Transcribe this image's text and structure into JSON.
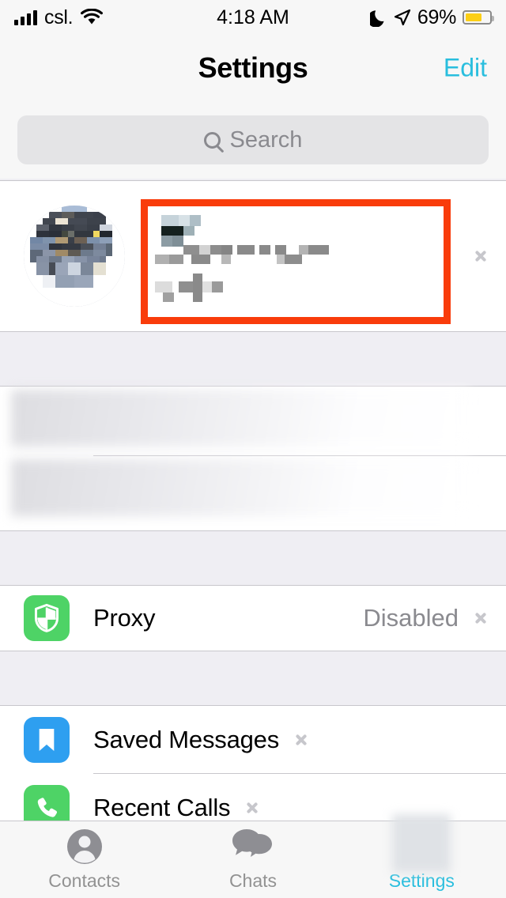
{
  "status_bar": {
    "carrier": "csl.",
    "time": "4:18 AM",
    "battery_percent": "69%",
    "signal_icon": "signal-bars-icon",
    "wifi_icon": "wifi-icon",
    "dnd_icon": "moon-icon",
    "location_icon": "location-arrow-icon",
    "battery_icon": "battery-icon",
    "battery_level": 69
  },
  "nav": {
    "title": "Settings",
    "edit_label": "Edit"
  },
  "search": {
    "placeholder": "Search",
    "icon": "search-icon"
  },
  "profile": {
    "name": "",
    "phone": "",
    "username": "",
    "redacted": true,
    "chevron": "chevron-right-icon",
    "highlight_color": "#F93C0B"
  },
  "sections": {
    "redacted_group": {
      "rows": [
        {
          "label": "",
          "redacted": true
        },
        {
          "label": "",
          "redacted": true
        }
      ]
    },
    "proxy_group": {
      "rows": [
        {
          "label": "Proxy",
          "value": "Disabled",
          "icon": "shield-icon",
          "icon_color": "#4ED366",
          "chevron": "chevron-right-icon"
        }
      ]
    },
    "messages_group": {
      "rows": [
        {
          "label": "Saved Messages",
          "value": "",
          "icon": "bookmark-icon",
          "icon_color": "#2E9FF0",
          "chevron": "chevron-right-icon"
        },
        {
          "label": "Recent Calls",
          "value": "",
          "icon": "phone-icon",
          "icon_color": "#4ED366",
          "chevron": "chevron-right-icon"
        }
      ]
    }
  },
  "tabbar": {
    "tabs": [
      {
        "label": "Contacts",
        "icon": "person-icon",
        "active": false
      },
      {
        "label": "Chats",
        "icon": "chat-bubbles-icon",
        "active": false
      },
      {
        "label": "Settings",
        "icon": "gear-icon",
        "active": true,
        "redacted": true
      }
    ],
    "active_color": "#29BEDE",
    "inactive_color": "#929292"
  }
}
